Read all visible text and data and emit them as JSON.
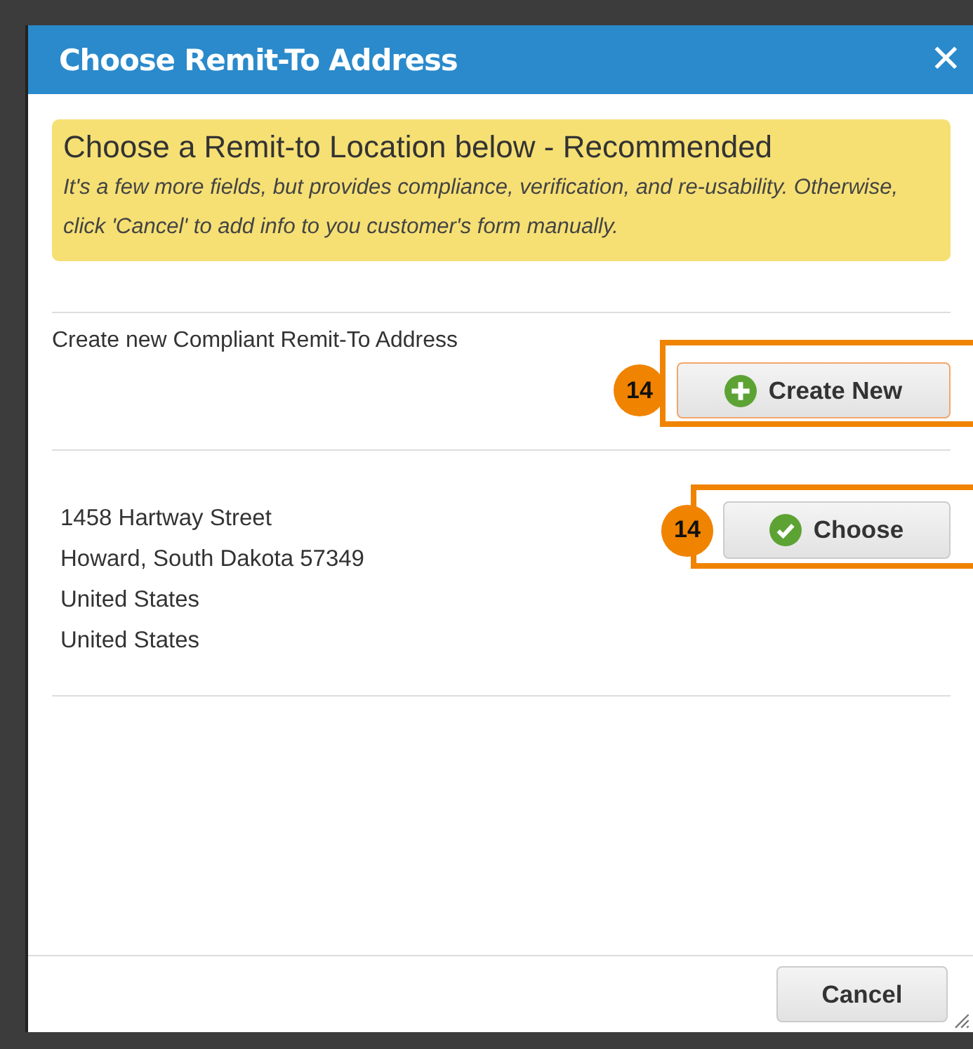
{
  "dialog": {
    "title": "Choose Remit-To Address",
    "close": "✕"
  },
  "notice": {
    "heading": "Choose a Remit-to Location below - Recommended",
    "text": "It's a few more fields, but provides compliance, verification, and re-usability. Otherwise, click 'Cancel' to add info to you customer's form manually."
  },
  "create_section": {
    "label": "Create new Compliant Remit-To Address",
    "button": {
      "label": "Create New",
      "annotation": "14"
    }
  },
  "addresses": [
    {
      "lines": [
        "1458 Hartway Street",
        "Howard, South Dakota 57349",
        "United States",
        "United States"
      ],
      "button": {
        "label": "Choose",
        "annotation": "14"
      }
    }
  ],
  "footer": {
    "buttons": [
      "Cancel"
    ]
  }
}
